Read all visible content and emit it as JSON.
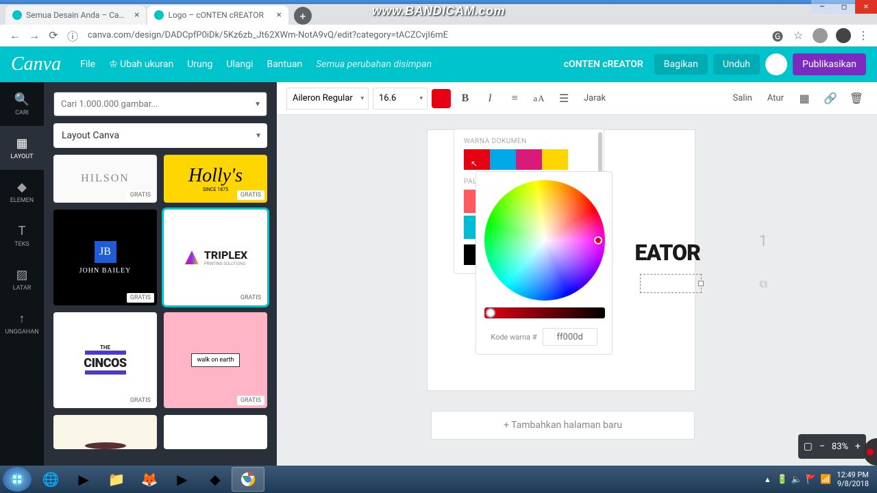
{
  "watermark": "www.BANDICAM.com",
  "tabs": [
    {
      "title": "Semua Desain Anda – Canva"
    },
    {
      "title": "Logo – cONTEN cREATOR"
    }
  ],
  "url": "canva.com/design/DADCpfP0iDk/5Kz6zb_Jt62XWm-NotA9vQ/edit?category=tACZCvjI6mE",
  "header": {
    "logo": "Canva",
    "file": "File",
    "resize": "Ubah ukuran",
    "undo": "Urung",
    "redo": "Ulangi",
    "help": "Bantuan",
    "saved": "Semua perubahan disimpan",
    "doc_title": "cONTEN cREATOR",
    "share": "Bagikan",
    "download": "Unduh",
    "publish": "Publikasikan"
  },
  "sidenav": {
    "search": "CARI",
    "layout": "LAYOUT",
    "elements": "ELEMEN",
    "text": "TEKS",
    "background": "LATAR",
    "uploads": "UNGGAHAN"
  },
  "panel": {
    "search_ph": "Cari 1.000.000 gambar...",
    "layout_dd": "Layout Canva",
    "free": "GRATIS",
    "templates": {
      "hilson": "HILSON",
      "hollys": "Holly's",
      "hollys_sub": "SINCE 1875",
      "jb": "JB",
      "jb_name": "JOHN BAILEY",
      "triplex": "TRIPLEX",
      "triplex_sub": "PRINTING SOLUTIONS",
      "cincos_pre": "THE",
      "cincos": "CINCOS",
      "walk": "walk on earth"
    }
  },
  "toolbar": {
    "font": "Aileron Regular",
    "size": "16.6",
    "spacing": "Jarak",
    "copy": "Salin",
    "arrange": "Atur"
  },
  "picker": {
    "doc_colors": "WARNA DOKUMEN",
    "palette": "PALET",
    "doc_sw": [
      "#e60012",
      "#00a8e8",
      "#d81b7a",
      "#ffd600"
    ],
    "pal_sw": [
      "#e60012",
      "#00bcd4"
    ],
    "hex_label": "Kode warna #",
    "hex": "ff000d"
  },
  "canvas": {
    "text_fragment": "EATOR",
    "page_num": "1",
    "add_page": "+ Tambahkan halaman baru"
  },
  "zoom": {
    "pct": "83%"
  },
  "taskbar": {
    "time": "12:49 PM",
    "date": "9/8/2018"
  }
}
